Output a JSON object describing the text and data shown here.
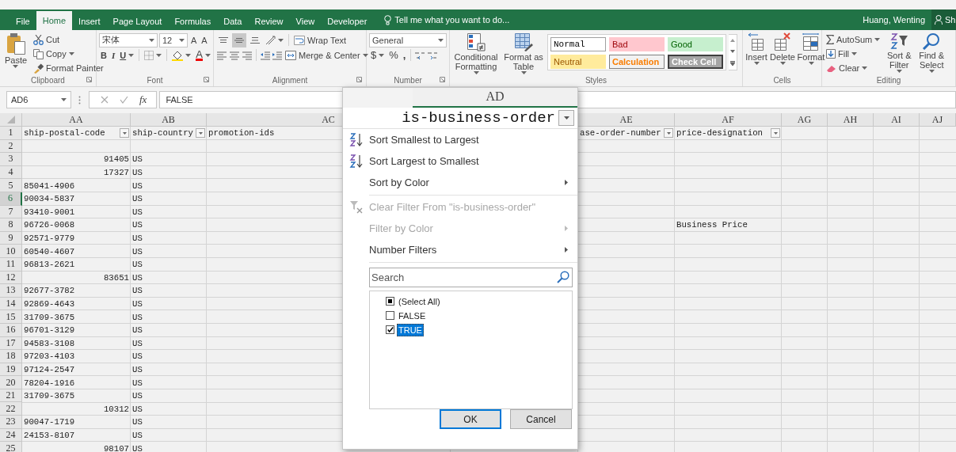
{
  "tabs": [
    {
      "label": "File",
      "selected": false
    },
    {
      "label": "Home",
      "selected": true
    },
    {
      "label": "Insert",
      "selected": false
    },
    {
      "label": "Page Layout",
      "selected": false
    },
    {
      "label": "Formulas",
      "selected": false
    },
    {
      "label": "Data",
      "selected": false
    },
    {
      "label": "Review",
      "selected": false
    },
    {
      "label": "View",
      "selected": false
    },
    {
      "label": "Developer",
      "selected": false
    }
  ],
  "tell_me": "Tell me what you want to do...",
  "user": "Huang, Wenting",
  "share": "Sh",
  "ribbon": {
    "clipboard": {
      "label": "Clipboard",
      "paste": "Paste",
      "cut": "Cut",
      "copy": "Copy",
      "format_painter": "Format Painter"
    },
    "font": {
      "label": "Font",
      "name": "宋体",
      "size": "12",
      "grow": "A",
      "shrink": "A",
      "bold": "B",
      "italic": "I",
      "underline": "U",
      "font_color": "A"
    },
    "alignment": {
      "label": "Alignment",
      "vertical_align": [
        {
          "selected": false
        },
        {
          "selected": true
        },
        {
          "selected": false
        }
      ],
      "wrap": "Wrap Text",
      "merge": "Merge & Center"
    },
    "number": {
      "label": "Number",
      "format": "General",
      "currency": "$",
      "percent": "%",
      "comma": ","
    },
    "styles": {
      "label": "Styles",
      "conditional": "Conditional Formatting",
      "table": "Format as Table",
      "cell_styles": [
        {
          "label": "Normal",
          "kind": "normal"
        },
        {
          "label": "Bad",
          "kind": "bad"
        },
        {
          "label": "Good",
          "kind": "good"
        },
        {
          "label": "Neutral",
          "kind": "neutral"
        },
        {
          "label": "Calculation",
          "kind": "calculation"
        },
        {
          "label": "Check Cell",
          "kind": "check"
        }
      ]
    },
    "cells": {
      "label": "Cells",
      "buttons": [
        "Insert",
        "Delete",
        "Format"
      ]
    },
    "editing": {
      "label": "Editing",
      "autosum": "AutoSum",
      "fill": "Fill",
      "clear": "Clear",
      "sort": "Sort & Filter",
      "find": "Find & Select"
    }
  },
  "formula_bar": {
    "name_box": "AD6",
    "fx": "fx",
    "value": "FALSE"
  },
  "sheet": {
    "columns": [
      "AA",
      "AB",
      "AC",
      "AE",
      "AF",
      "AG",
      "AH",
      "AI",
      "AJ"
    ],
    "header_row": {
      "label": "1",
      "selected": false,
      "cells": [
        {
          "text": "ship-postal-code",
          "filter": true
        },
        {
          "text": "ship-country",
          "filter": true
        },
        {
          "text": "promotion-ids",
          "filter": false
        },
        {
          "text": "ase-order-number",
          "filter": true
        },
        {
          "text": "price-designation",
          "filter": true
        }
      ]
    },
    "rows": [
      {
        "label": "2",
        "selected": false
      },
      {
        "label": "3",
        "selected": false,
        "cells": [
          {
            "text": "91405",
            "kind": "number"
          },
          {
            "text": "US",
            "kind": "text"
          }
        ]
      },
      {
        "label": "4",
        "selected": false,
        "cells": [
          {
            "text": "17327",
            "kind": "number"
          },
          {
            "text": "US",
            "kind": "text"
          }
        ]
      },
      {
        "label": "5",
        "selected": false,
        "cells": [
          {
            "text": "85041-4906",
            "kind": "text"
          },
          {
            "text": "US",
            "kind": "text"
          }
        ]
      },
      {
        "label": "6",
        "selected": true,
        "cells": [
          {
            "text": "90034-5837",
            "kind": "text"
          },
          {
            "text": "US",
            "kind": "text"
          }
        ]
      },
      {
        "label": "7",
        "selected": false,
        "cells": [
          {
            "text": "93410-9001",
            "kind": "text"
          },
          {
            "text": "US",
            "kind": "text"
          }
        ]
      },
      {
        "label": "8",
        "selected": false,
        "cells": [
          {
            "text": "96726-0068",
            "kind": "text"
          },
          {
            "text": "US",
            "kind": "text"
          },
          null,
          null,
          {
            "text": "Business Price",
            "kind": "text"
          }
        ]
      },
      {
        "label": "9",
        "selected": false,
        "cells": [
          {
            "text": "92571-9779",
            "kind": "text"
          },
          {
            "text": "US",
            "kind": "text"
          }
        ]
      },
      {
        "label": "10",
        "selected": false,
        "cells": [
          {
            "text": "60540-4607",
            "kind": "text"
          },
          {
            "text": "US",
            "kind": "text"
          }
        ]
      },
      {
        "label": "11",
        "selected": false,
        "cells": [
          {
            "text": "96813-2621",
            "kind": "text"
          },
          {
            "text": "US",
            "kind": "text"
          }
        ]
      },
      {
        "label": "12",
        "selected": false,
        "cells": [
          {
            "text": "83651",
            "kind": "number"
          },
          {
            "text": "US",
            "kind": "text"
          }
        ]
      },
      {
        "label": "13",
        "selected": false,
        "cells": [
          {
            "text": "92677-3782",
            "kind": "text"
          },
          {
            "text": "US",
            "kind": "text"
          }
        ]
      },
      {
        "label": "14",
        "selected": false,
        "cells": [
          {
            "text": "92869-4643",
            "kind": "text"
          },
          {
            "text": "US",
            "kind": "text"
          }
        ]
      },
      {
        "label": "15",
        "selected": false,
        "cells": [
          {
            "text": "31709-3675",
            "kind": "text"
          },
          {
            "text": "US",
            "kind": "text"
          }
        ]
      },
      {
        "label": "16",
        "selected": false,
        "cells": [
          {
            "text": "96701-3129",
            "kind": "text"
          },
          {
            "text": "US",
            "kind": "text"
          }
        ]
      },
      {
        "label": "17",
        "selected": false,
        "cells": [
          {
            "text": "94583-3108",
            "kind": "text"
          },
          {
            "text": "US",
            "kind": "text"
          }
        ]
      },
      {
        "label": "18",
        "selected": false,
        "cells": [
          {
            "text": "97203-4103",
            "kind": "text"
          },
          {
            "text": "US",
            "kind": "text"
          }
        ]
      },
      {
        "label": "19",
        "selected": false,
        "cells": [
          {
            "text": "97124-2547",
            "kind": "text"
          },
          {
            "text": "US",
            "kind": "text"
          }
        ]
      },
      {
        "label": "20",
        "selected": false,
        "cells": [
          {
            "text": "78204-1916",
            "kind": "text"
          },
          {
            "text": "US",
            "kind": "text"
          }
        ]
      },
      {
        "label": "21",
        "selected": false,
        "cells": [
          {
            "text": "31709-3675",
            "kind": "text"
          },
          {
            "text": "US",
            "kind": "text"
          }
        ]
      },
      {
        "label": "22",
        "selected": false,
        "cells": [
          {
            "text": "10312",
            "kind": "number"
          },
          {
            "text": "US",
            "kind": "text"
          }
        ]
      },
      {
        "label": "23",
        "selected": false,
        "cells": [
          {
            "text": "90047-1719",
            "kind": "text"
          },
          {
            "text": "US",
            "kind": "text"
          }
        ]
      },
      {
        "label": "24",
        "selected": false,
        "cells": [
          {
            "text": "24153-8107",
            "kind": "text"
          },
          {
            "text": "US",
            "kind": "text"
          }
        ]
      },
      {
        "label": "25",
        "selected": false,
        "cells": [
          {
            "text": "98107",
            "kind": "number"
          },
          {
            "text": "US",
            "kind": "text"
          }
        ]
      }
    ]
  },
  "filter_menu": {
    "column": "AD",
    "field": "is-business-order",
    "items": [
      {
        "label": "Sort Smallest to Largest",
        "kind": "sort-ascending",
        "disabled": false,
        "submenu": false
      },
      {
        "label": "Sort Largest to Smallest",
        "kind": "sort-descending",
        "disabled": false,
        "submenu": false
      },
      {
        "label": "Sort by Color",
        "kind": "plain",
        "disabled": false,
        "submenu": true
      },
      {
        "label": "Clear Filter From \"is-business-order\"",
        "kind": "clear-filter",
        "disabled": true,
        "submenu": false
      },
      {
        "label": "Filter by Color",
        "kind": "plain",
        "disabled": true,
        "submenu": true
      },
      {
        "label": "Number Filters",
        "kind": "plain",
        "disabled": false,
        "submenu": true
      }
    ],
    "search": {
      "placeholder": "Search"
    },
    "values": [
      {
        "label": "(Select All)",
        "checked": false,
        "partial": true,
        "selected": false
      },
      {
        "label": "FALSE",
        "checked": false,
        "partial": false,
        "selected": false
      },
      {
        "label": "TRUE",
        "checked": true,
        "partial": false,
        "selected": true
      }
    ],
    "buttons": [
      {
        "label": "OK",
        "focused": true
      },
      {
        "label": "Cancel",
        "focused": false
      }
    ]
  }
}
